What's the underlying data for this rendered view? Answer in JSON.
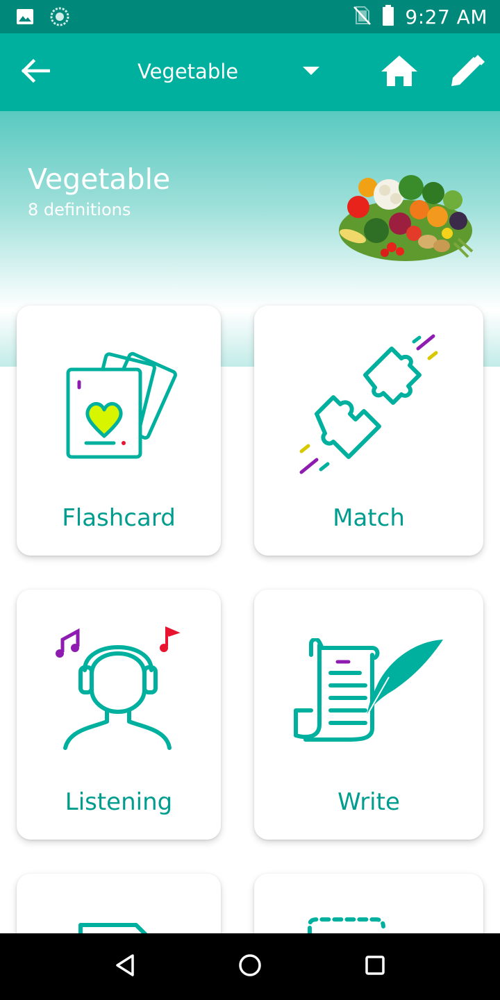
{
  "status_bar": {
    "time": "9:27 AM",
    "icons": [
      "image-icon",
      "sync-icon",
      "no-sim-icon",
      "battery-icon"
    ]
  },
  "app_bar": {
    "title": "Vegetable",
    "icons": [
      "back-arrow-icon",
      "dropdown-arrow-icon",
      "home-icon",
      "edit-pencil-icon"
    ],
    "color": "#00b09f"
  },
  "hero": {
    "title": "Vegetable",
    "subtitle": "8 definitions",
    "image": "vegetables-image"
  },
  "modes": [
    {
      "label": "Flashcard",
      "icon": "flashcard-icon"
    },
    {
      "label": "Match",
      "icon": "puzzle-match-icon"
    },
    {
      "label": "Listening",
      "icon": "headphones-listening-icon"
    },
    {
      "label": "Write",
      "icon": "quill-write-icon"
    },
    {
      "label": "",
      "icon": "folder-icon"
    },
    {
      "label": "",
      "icon": "dashed-box-icon"
    }
  ],
  "nav_bar": {
    "icons": [
      "back-triangle-icon",
      "home-circle-icon",
      "recents-square-icon"
    ]
  },
  "colors": {
    "status_bar": "#00897b",
    "accent": "#00b09f",
    "label_text": "#009d8f",
    "heart": "#d8f500",
    "purple": "#8e1cb0",
    "red": "#e8132f"
  }
}
